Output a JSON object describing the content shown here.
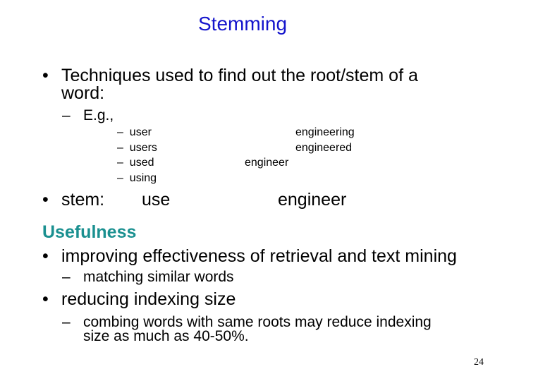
{
  "slide": {
    "title": "Stemming",
    "colors": {
      "title": "#1414cc",
      "section_heading": "#1a9090",
      "body": "#000000"
    },
    "bullets": {
      "techniques_line1": "Techniques used to find out the root/stem of a",
      "techniques_line2": "word:",
      "eg_label": "E.g.,",
      "examples_left": [
        "user",
        "users",
        "used",
        "using"
      ],
      "examples_right": [
        "engineering",
        "engineered",
        "engineer"
      ],
      "stem_label": "stem:",
      "stem_left": "use",
      "stem_right": "engineer"
    },
    "usefulness": {
      "heading": "Usefulness",
      "point1": "improving effectiveness of retrieval and text mining",
      "point1_sub": "matching similar words",
      "point2": "reducing indexing size",
      "point2_sub_line1": "combing words with same roots may reduce indexing",
      "point2_sub_line2": "size as much as 40-50%."
    },
    "bullet_glyph": "•",
    "dash_glyph": "–",
    "page_number": "24"
  }
}
